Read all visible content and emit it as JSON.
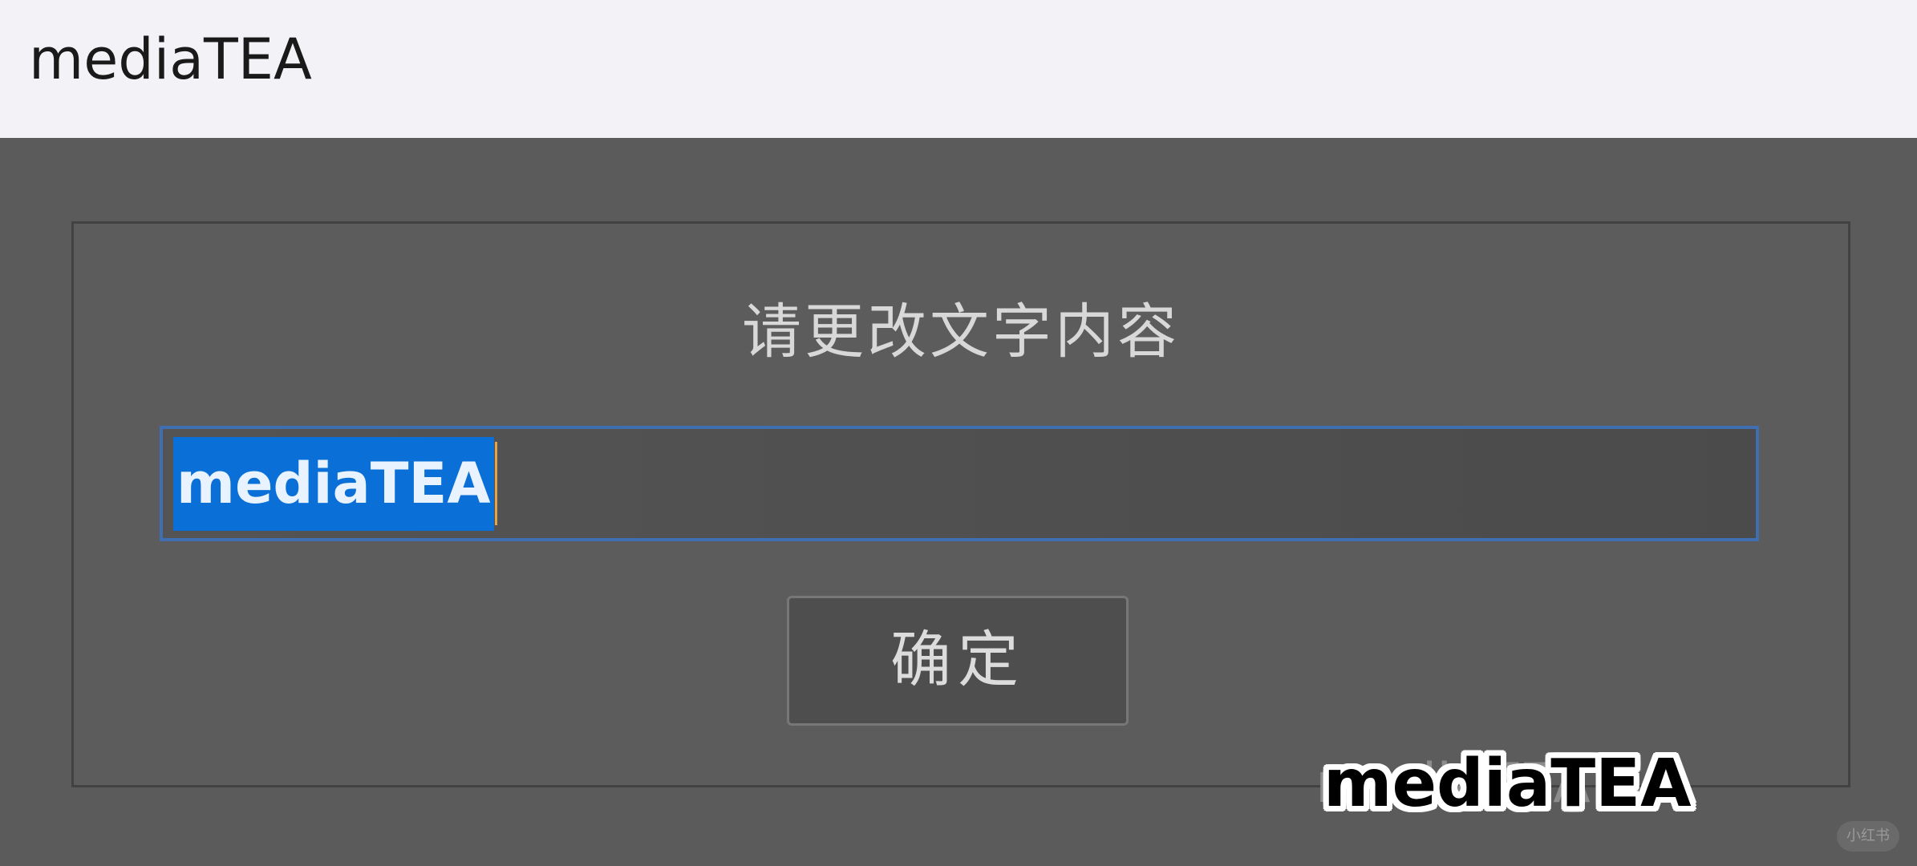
{
  "window": {
    "title": "mediaTEA"
  },
  "dialog": {
    "prompt": "请更改文字内容",
    "input_value": "mediaTEA",
    "ok_label": "确定"
  },
  "overlay": {
    "watermark_bold": "mediaTEA",
    "watermark_faint": "mediaTEA",
    "corner_badge": "小红书"
  },
  "colors": {
    "selection": "#0a6fd6",
    "input_border": "#3f6fb0",
    "dialog_background": "#5c5c5c",
    "titlebar_background": "#f3f3f7"
  }
}
